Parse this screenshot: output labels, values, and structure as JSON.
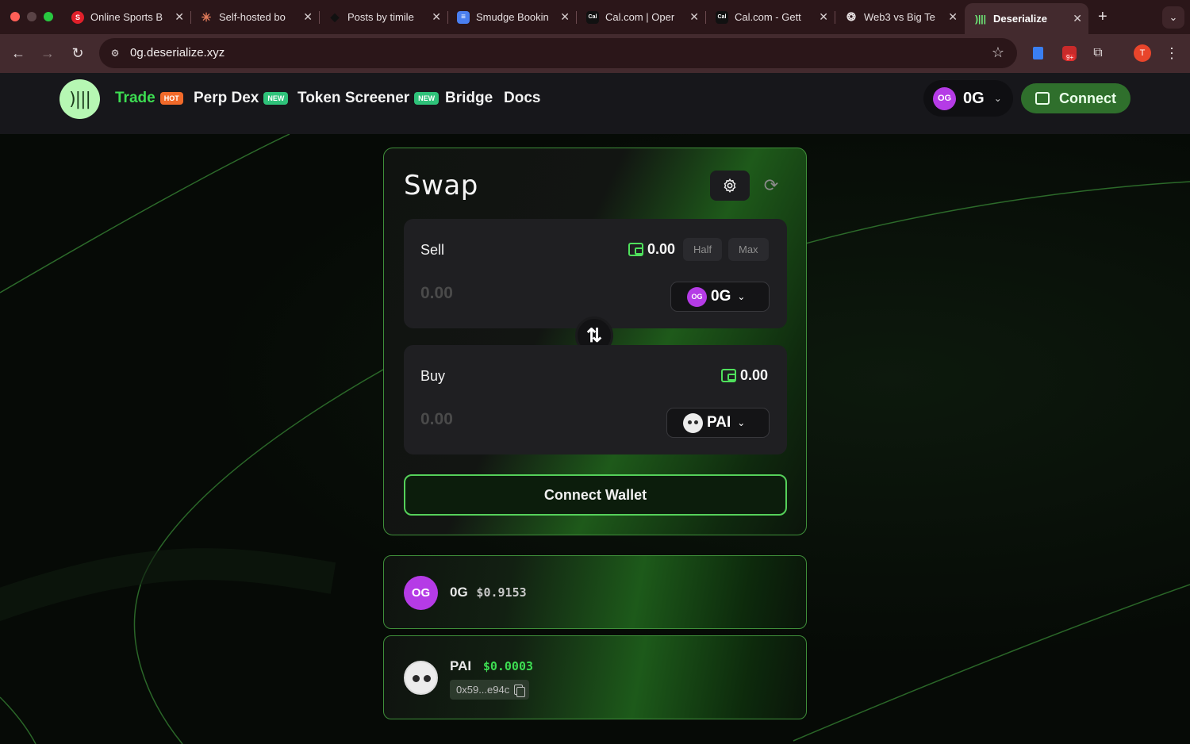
{
  "browser": {
    "tabs": [
      {
        "title": "Online Sports B",
        "icon": "red-s-favicon"
      },
      {
        "title": "Self-hosted bo",
        "icon": "sunburst-favicon"
      },
      {
        "title": "Posts by timile",
        "icon": "diamond-favicon"
      },
      {
        "title": "Smudge Bookin",
        "icon": "docs-favicon"
      },
      {
        "title": "Cal.com | Oper",
        "icon": "cal-favicon"
      },
      {
        "title": "Cal.com - Gett",
        "icon": "cal-favicon"
      },
      {
        "title": "Web3 vs Big Te",
        "icon": "openai-favicon"
      },
      {
        "title": "Deserialize",
        "icon": "deserialize-favicon",
        "active": true
      }
    ],
    "url": "0g.deserialize.xyz",
    "profile_initial": "T",
    "ext_badge": "9+"
  },
  "header": {
    "logo_glyph": ")|||",
    "nav": [
      {
        "label": "Trade",
        "badge": "HOT"
      },
      {
        "label": "Perp Dex",
        "badge": "NEW"
      },
      {
        "label": "Token Screener",
        "badge": "NEW"
      },
      {
        "label": "Bridge",
        "badge": ""
      },
      {
        "label": "Docs",
        "badge": ""
      }
    ],
    "chain": {
      "label": "0G",
      "icon_text": "OG"
    },
    "connect_label": "Connect"
  },
  "swap": {
    "title": "Swap",
    "sell": {
      "label": "Sell",
      "balance": "0.00",
      "half_label": "Half",
      "max_label": "Max",
      "amount": "0.00",
      "token": "0G",
      "token_icon_text": "OG"
    },
    "buy": {
      "label": "Buy",
      "balance": "0.00",
      "amount": "0.00",
      "token": "PAI"
    },
    "connect_wallet_label": "Connect Wallet"
  },
  "token_cards": [
    {
      "symbol": "0G",
      "price": "$0.9153",
      "icon_text": "OG"
    },
    {
      "symbol": "PAI",
      "price": "$0.0003",
      "address": "0x59...e94c"
    }
  ],
  "colors": {
    "accent_green": "#3ddd52",
    "og_purple": "#b53be6",
    "hot_badge": "#f16a2a",
    "new_badge": "#2fc27a"
  }
}
